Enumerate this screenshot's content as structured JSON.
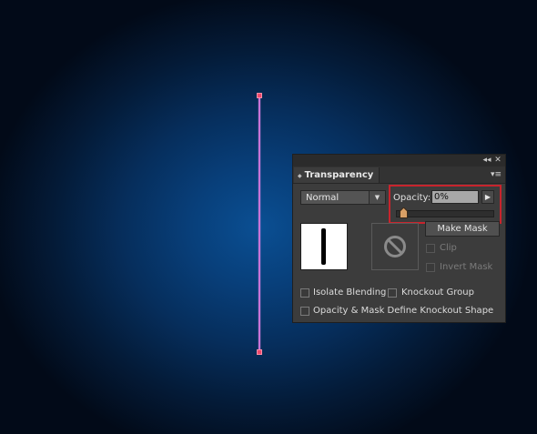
{
  "panel": {
    "tab_label": "Transparency",
    "tab_arrows": "◆",
    "collapse_glyph": "◂◂",
    "close_glyph": "✕",
    "menu_glyph": "▾≡",
    "blend_mode": "Normal",
    "opacity_label": "Opacity:",
    "opacity_value": "0%",
    "opacity_fraction": 0.0,
    "make_mask_label": "Make Mask",
    "clip_label": "Clip",
    "invert_mask_label": "Invert Mask",
    "isolate_blending_label": "Isolate Blending",
    "knockout_group_label": "Knockout Group",
    "define_knockout_label": "Opacity & Mask Define Knockout Shape"
  },
  "colors": {
    "highlight": "#c8242d",
    "path_stroke": "#c873d6",
    "anchor": "#f0486c",
    "canvas_center": "#0a4f93"
  },
  "icons": {
    "mask_placeholder": "no-symbol-icon",
    "slider_thumb": "slider-thumb-icon"
  }
}
